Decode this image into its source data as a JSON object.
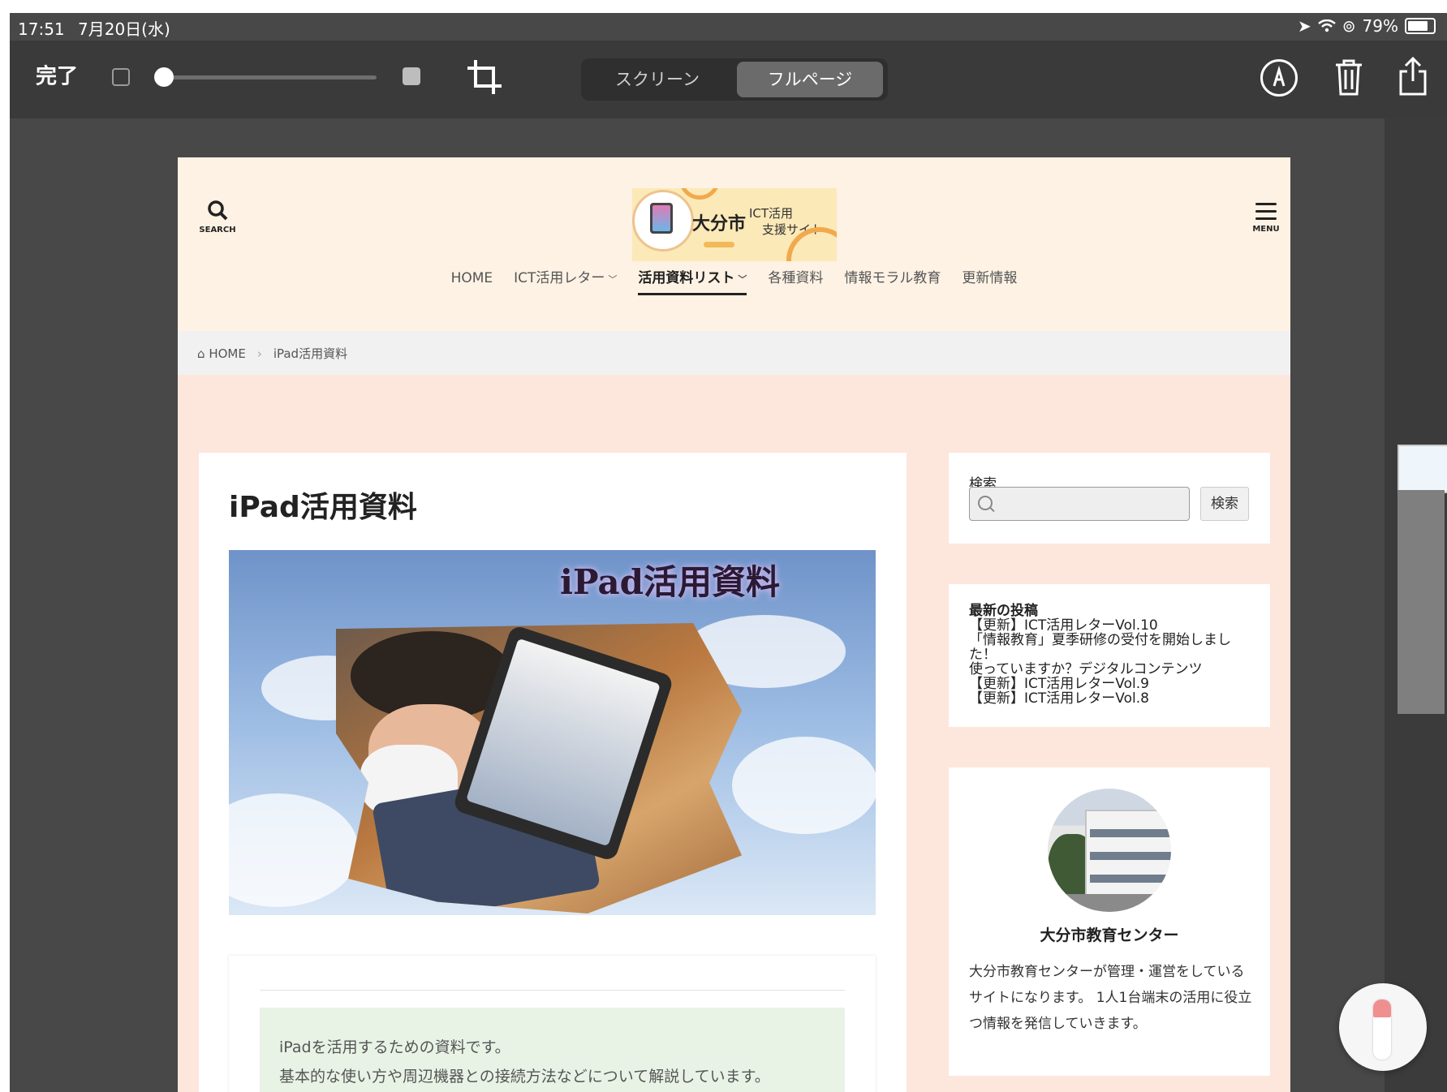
{
  "status_bar": {
    "time": "17:51",
    "date": "7月20日(水)",
    "battery": "79%"
  },
  "toolbar": {
    "done_label": "完了",
    "segment_screen": "スクリーン",
    "segment_fullpage": "フルページ",
    "selected_segment": "フルページ"
  },
  "site": {
    "search_label": "SEARCH",
    "menu_label": "MENU",
    "logo": {
      "city": "大分市",
      "line1": "ICT活用",
      "line2": "支援サイト"
    },
    "nav": [
      "HOME",
      "ICT活用レター",
      "活用資料リスト",
      "各種資料",
      "情報モラル教育",
      "更新情報"
    ],
    "nav_active": "活用資料リスト",
    "breadcrumb": {
      "home": "HOME",
      "current": "iPad活用資料"
    }
  },
  "main": {
    "title": "iPad活用資料",
    "hero_text": "iPad活用資料",
    "body_line1": "iPadを活用するための資料です。",
    "body_line2": "基本的な使い方や周辺機器との接続方法などについて解説しています。"
  },
  "sidebar": {
    "search": {
      "heading": "検索",
      "button": "検索",
      "placeholder": ""
    },
    "recent_posts": {
      "heading": "最新の投稿",
      "items": [
        "【更新】ICT活用レターVol.10",
        "「情報教育」夏季研修の受付を開始しました！",
        "使っていますか？デジタルコンテンツ",
        "【更新】ICT活用レターVol.9",
        "【更新】ICT活用レターVol.8"
      ]
    },
    "profile": {
      "name": "大分市教育センター",
      "description": "大分市教育センターが管理・運営をしているサイトになります。 1人1台端末の活用に役立つ情報を発信していきます。"
    }
  },
  "colors": {
    "header_bg": "#fdf2e4",
    "page_bg": "#fde6dc",
    "toolbar_bg": "#3a3a3a"
  }
}
